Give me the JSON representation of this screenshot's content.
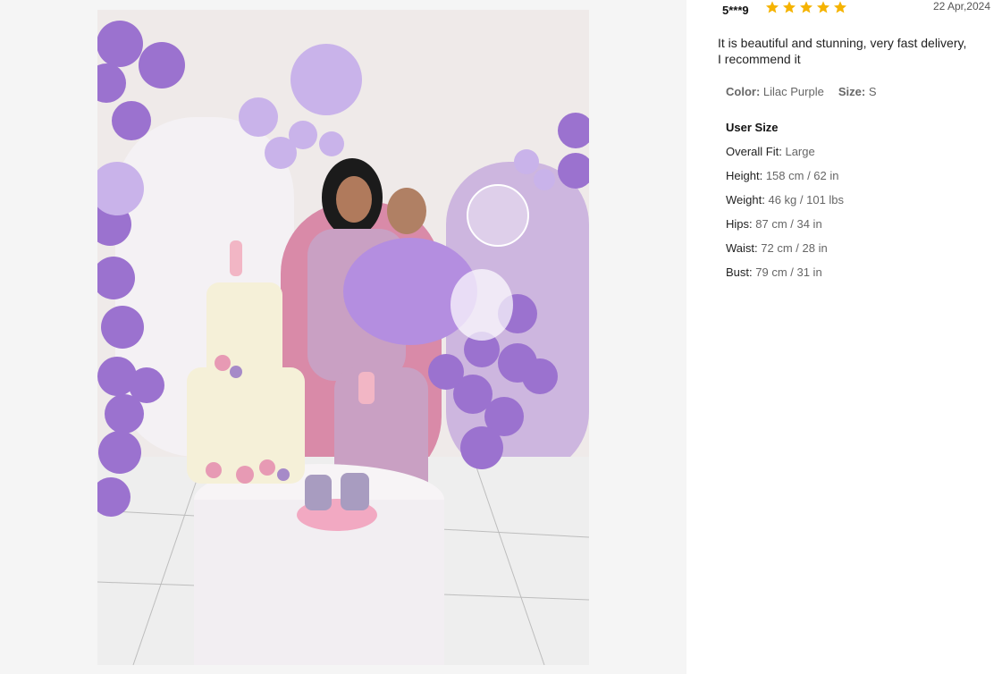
{
  "review": {
    "reviewer": "5***9",
    "rating": 5,
    "date": "22 Apr,2024",
    "text": "It is beautiful and stunning, very fast delivery, I recommend it",
    "color_label": "Color:",
    "color_value": "Lilac Purple",
    "size_label": "Size:",
    "size_value": "S",
    "user_size_title": "User Size",
    "measurements": [
      {
        "label": "Overall Fit:",
        "value": "Large"
      },
      {
        "label": "Height:",
        "value": "158 cm / 62 in"
      },
      {
        "label": "Weight:",
        "value": "46 kg / 101 lbs"
      },
      {
        "label": "Hips:",
        "value": "87 cm / 34 in"
      },
      {
        "label": "Waist:",
        "value": "72 cm / 28 in"
      },
      {
        "label": "Bust:",
        "value": "79 cm / 31 in"
      }
    ]
  },
  "colors": {
    "star": "#f5b301",
    "balloon": "#9b72cf",
    "balloon_light": "#c9b3ea",
    "wall": "#f1ecef",
    "arch_pink": "#d77fa1"
  }
}
